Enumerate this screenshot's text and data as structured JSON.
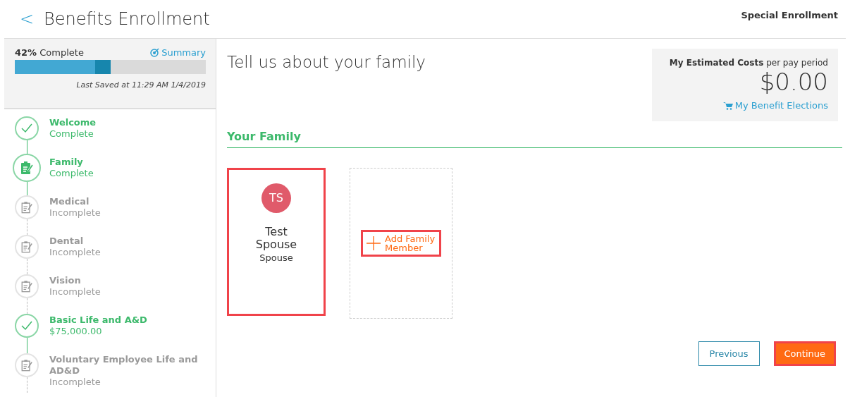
{
  "header": {
    "back": "<",
    "title": "Benefits Enrollment",
    "mode": "Special Enrollment"
  },
  "progress": {
    "percent": "42%",
    "label": "Complete",
    "summary_link": "Summary",
    "level": 0.42,
    "current_step": {
      "level": 0.5
    },
    "last_saved": "Last Saved at 11:29 AM 1/4/2019"
  },
  "steps": [
    {
      "name": "Welcome",
      "status": "Complete",
      "kind": "complete"
    },
    {
      "name": "Family",
      "status": "Complete",
      "kind": "current"
    },
    {
      "name": "Medical",
      "status": "Incomplete",
      "kind": "incomplete"
    },
    {
      "name": "Dental",
      "status": "Incomplete",
      "kind": "incomplete"
    },
    {
      "name": "Vision",
      "status": "Incomplete",
      "kind": "incomplete"
    },
    {
      "name": "Basic Life and A&D",
      "status": "$75,000.00",
      "kind": "complete"
    },
    {
      "name": "Voluntary Employee Life and AD&D",
      "status": "Incomplete",
      "kind": "incomplete"
    }
  ],
  "main": {
    "heading": "Tell us about your family",
    "section_title": "Your Family"
  },
  "costs": {
    "label": "My Estimated Costs",
    "suffix": "per pay period",
    "amount": "$0.00",
    "link": "My Benefit Elections"
  },
  "family_members": [
    {
      "initials": "TS",
      "name": "Test Spouse",
      "relation": "Spouse",
      "color": "#e05a6a",
      "highlighted": true
    }
  ],
  "add_member": {
    "label": "Add Family Member",
    "highlighted": true
  },
  "buttons": [
    {
      "label": "Previous",
      "kind": "secondary",
      "highlighted": false
    },
    {
      "label": "Continue",
      "kind": "primary",
      "highlighted": true
    }
  ]
}
